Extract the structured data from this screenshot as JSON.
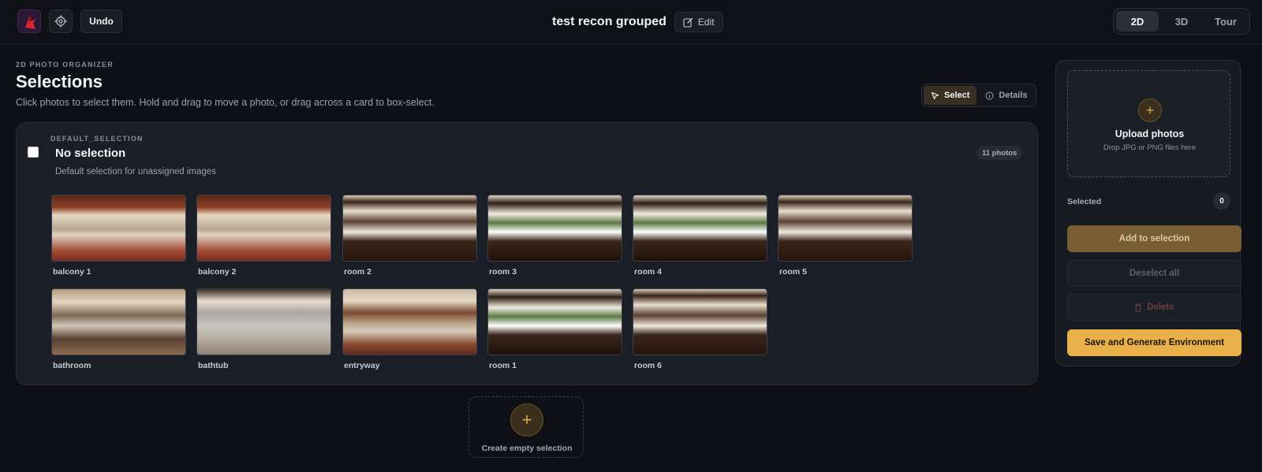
{
  "topbar": {
    "app_logo": "app-logo",
    "undo_label": "Undo",
    "project_title": "test recon grouped",
    "edit_label": "Edit",
    "view_modes": [
      {
        "label": "2D",
        "active": true
      },
      {
        "label": "3D",
        "active": false
      },
      {
        "label": "Tour",
        "active": false
      }
    ]
  },
  "header": {
    "eyebrow": "2D PHOTO ORGANIZER",
    "title": "Selections",
    "subtitle": "Click photos to select them. Hold and drag to move a photo, or drag across a card to box-select.",
    "mode_select": "Select",
    "mode_details": "Details"
  },
  "selection_card": {
    "key": "DEFAULT_SELECTION",
    "title": "No selection",
    "description": "Default selection for unassigned images",
    "count_label": "11 photos",
    "checked": false,
    "photos": [
      {
        "label": "balcony 1"
      },
      {
        "label": "balcony 2"
      },
      {
        "label": "room 2"
      },
      {
        "label": "room 3"
      },
      {
        "label": "room 4"
      },
      {
        "label": "room 5"
      },
      {
        "label": "bathroom"
      },
      {
        "label": "bathtub"
      },
      {
        "label": "entryway"
      },
      {
        "label": "room 1"
      },
      {
        "label": "room 6"
      }
    ]
  },
  "create_selection": {
    "label": "Create empty selection",
    "icon": "plus-icon"
  },
  "panel": {
    "upload_title": "Upload photos",
    "upload_hint": "Drop JPG or PNG files here",
    "selected_label": "Selected",
    "selected_count": "0",
    "add_label": "Add to selection",
    "deselect_label": "Deselect all",
    "delete_label": "Delete",
    "save_label": "Save and Generate Environment"
  },
  "colors": {
    "accent": "#eab04a",
    "background": "#0e1015",
    "card": "#1a1e27"
  }
}
